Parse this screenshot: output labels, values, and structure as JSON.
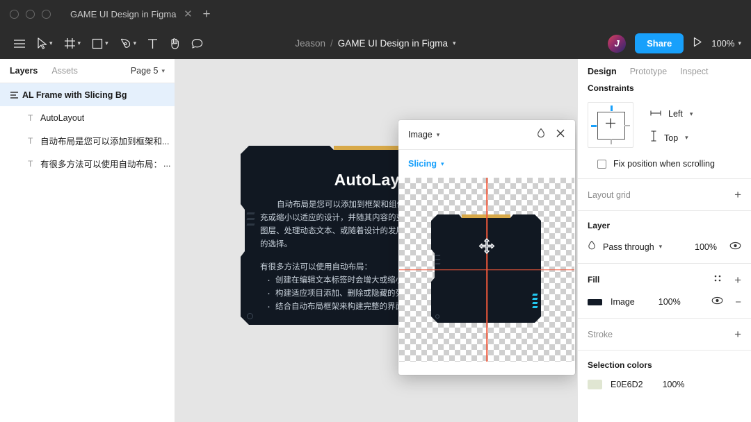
{
  "titlebar": {
    "tab_label": "GAME UI Design in Figma",
    "close_icon": "close-icon",
    "new_tab_icon": "plus-icon"
  },
  "toolbar": {
    "menu_icon": "hamburger-menu-icon",
    "move_icon": "move-tool-icon",
    "frame_icon": "frame-tool-icon",
    "shape_icon": "rectangle-tool-icon",
    "pen_icon": "pen-tool-icon",
    "text_icon": "text-tool-icon",
    "hand_icon": "hand-tool-icon",
    "comment_icon": "comment-tool-icon",
    "breadcrumb_user": "Jeason",
    "breadcrumb_sep": "/",
    "breadcrumb_file": "GAME UI Design in Figma",
    "avatar_initial": "J",
    "share_label": "Share",
    "present_icon": "present-play-icon",
    "zoom_value": "100%",
    "accent_color": "#18A0FB"
  },
  "left_panel": {
    "tab_layers": "Layers",
    "tab_assets": "Assets",
    "page_label": "Page 5",
    "layers": [
      {
        "name": "AL Frame with Slicing Bg",
        "icon": "auto-layout-icon",
        "selected": true
      },
      {
        "name": "AutoLayout",
        "icon": "text-layer-icon",
        "selected": false
      },
      {
        "name": "自动布局是您可以添加到框架和...",
        "icon": "text-layer-icon",
        "selected": false
      },
      {
        "name": "有很多方法可以使用自动布局：",
        "icon": "text-layer-icon",
        "selected": false,
        "ellipsis": "..."
      }
    ]
  },
  "canvas": {
    "art_title": "AutoLayout",
    "paragraph": "自动布局是您可以添加到框架和组件的属性。它可以创建可以填充或缩小以适应的设计，并随其内容的变化而重排。当您需要添加新图层、处理动态文本、或随着设计的发展保持对齐时，这是一个理想的选择。",
    "list_intro": "有很多方法可以使用自动布局：",
    "list_items": [
      "创建在编辑文本标签时会增大或缩小的按钮",
      "构建适应项目添加、删除或隐藏的列表与网格",
      "结合自动布局框架来构建完整的界面布局"
    ]
  },
  "modal": {
    "title": "Image",
    "title_chevron": "chevron-down-icon",
    "droplet_icon": "droplet-icon",
    "close_icon": "close-icon",
    "slicing_label": "Slicing",
    "slicing_chevron": "chevron-down-icon",
    "cursor_icon": "move-cursor-icon",
    "guide_color": "#F2593B"
  },
  "right_panel": {
    "tab_design": "Design",
    "tab_prototype": "Prototype",
    "tab_inspect": "Inspect",
    "constraints": {
      "title": "Constraints",
      "horizontal_icon": "horizontal-constraint-icon",
      "horizontal_value": "Left",
      "vertical_icon": "vertical-constraint-icon",
      "vertical_value": "Top",
      "fix_position_label": "Fix position when scrolling",
      "fix_position_checked": false,
      "active_color": "#18A0FB"
    },
    "layout_grid": {
      "title": "Layout grid",
      "add_icon": "plus-icon"
    },
    "layer": {
      "title": "Layer",
      "blend_icon": "blend-mode-icon",
      "blend_mode": "Pass through",
      "opacity": "100%",
      "visibility_icon": "eye-icon"
    },
    "fill": {
      "title": "Fill",
      "grid_icon": "styles-grid-icon",
      "add_icon": "plus-icon",
      "swatch_color": "#121A26",
      "type": "Image",
      "opacity": "100%",
      "visibility_icon": "eye-icon",
      "remove_icon": "minus-icon"
    },
    "stroke": {
      "title": "Stroke",
      "add_icon": "plus-icon"
    },
    "selection_colors": {
      "title": "Selection colors",
      "swatch_color": "#E0E6D2",
      "hex": "E0E6D2",
      "opacity": "100%"
    }
  }
}
